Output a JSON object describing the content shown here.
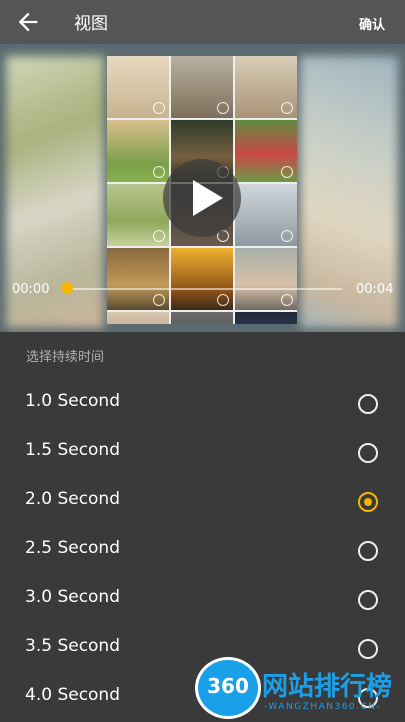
{
  "header": {
    "title": "视图",
    "confirm_label": "确认",
    "back_icon": "arrow-left-icon"
  },
  "player": {
    "current_time": "00:00",
    "total_time": "00:04",
    "progress": 0.0,
    "accent": "#f6b600",
    "play_icon": "play-icon"
  },
  "section_title": "选择持续时间",
  "durations": [
    {
      "label": "1.0 Second",
      "selected": false
    },
    {
      "label": "1.5 Second",
      "selected": false
    },
    {
      "label": "2.0 Second",
      "selected": true
    },
    {
      "label": "2.5 Second",
      "selected": false
    },
    {
      "label": "3.0 Second",
      "selected": false
    },
    {
      "label": "3.5 Second",
      "selected": false
    },
    {
      "label": "4.0 Second",
      "selected": false
    }
  ],
  "watermark": {
    "logo_text": "360",
    "name": "网站排行榜",
    "url": "-WANGZHAN360.CN-"
  }
}
